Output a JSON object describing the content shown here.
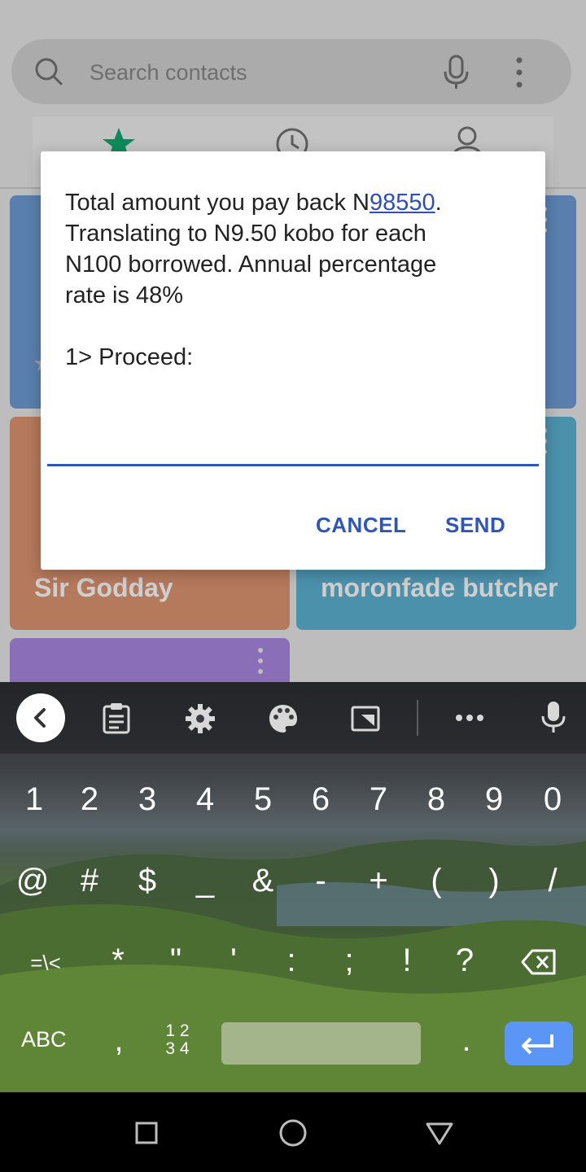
{
  "app": {
    "search_placeholder": "Search contacts",
    "contacts": [
      {
        "name": "Sir Godday",
        "color": "#b57a5d"
      },
      {
        "name": "moronfade butcher",
        "color": "#4d92ad"
      }
    ]
  },
  "dialog": {
    "line1_prefix": "Total amount you pay back N",
    "line1_link": "98550",
    "line1_suffix": ".",
    "line2": "Translating to N9.50 kobo for each",
    "line3": "N100 borrowed. Annual percentage",
    "line4": "rate is 48%",
    "line5": "1> Proceed:",
    "input_value": "",
    "cancel_label": "CANCEL",
    "send_label": "SEND",
    "accent": "#2f56b5"
  },
  "keyboard": {
    "row1": [
      "1",
      "2",
      "3",
      "4",
      "5",
      "6",
      "7",
      "8",
      "9",
      "0"
    ],
    "row2": [
      "@",
      "#",
      "$",
      "_",
      "&",
      "-",
      "+",
      "(",
      ")",
      "/"
    ],
    "row3": [
      "=\\<",
      "*",
      "\"",
      "'",
      ":",
      ";",
      "!",
      "?"
    ],
    "abc_label": "ABC",
    "comma": ",",
    "numpad_top": "1 2",
    "numpad_bottom": "3 4",
    "period": ".",
    "enter_color": "#5b95f5"
  }
}
